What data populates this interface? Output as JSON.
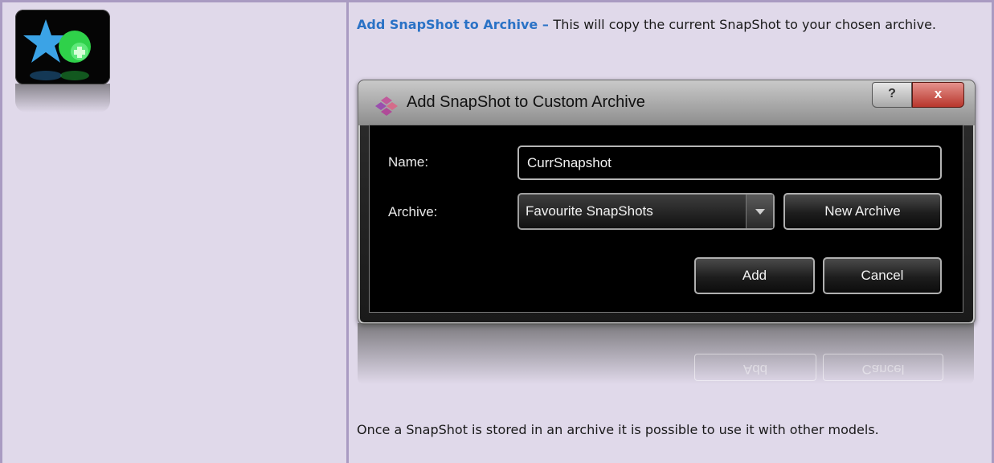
{
  "intro": {
    "feature_label": "Add SnapShot to Archive – ",
    "description": "This will copy the current SnapShot to your chosen archive."
  },
  "dialog": {
    "title": "Add SnapShot to Custom Archive",
    "help_label": "?",
    "close_label": "x",
    "name_label": "Name:",
    "name_value": "CurrSnapshot",
    "archive_label": "Archive:",
    "archive_selected": "Favourite SnapShots",
    "new_archive_label": "New Archive",
    "add_label": "Add",
    "cancel_label": "Cancel"
  },
  "reflection": {
    "add_label": "Add",
    "cancel_label": "Cancel"
  },
  "footer": {
    "text": "Once a SnapShot is stored in an archive it is possible to use it with other models."
  },
  "icons": {
    "toolbar_icon": "star-add-icon",
    "app_icon": "snapshot-app-icon"
  },
  "colors": {
    "feature_link": "#2a72c6",
    "page_background": "#e0d9ea",
    "border": "#a99bc2",
    "close_button": "#c0392b"
  }
}
